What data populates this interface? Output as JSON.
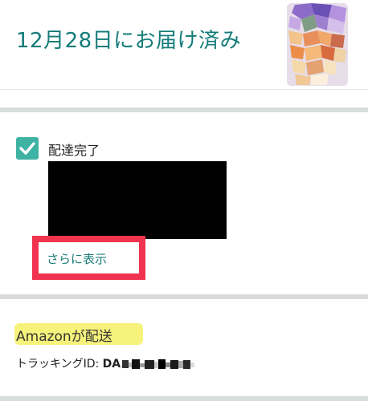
{
  "header": {
    "title": "12月28日にお届け済み",
    "thumbnail_icon": "product-photo-pixelated"
  },
  "delivery": {
    "status_label": "配達完了",
    "checkbox_icon": "checkmark-icon",
    "checked": true,
    "show_more_label": "さらに表示"
  },
  "shipping": {
    "shipper_brand": "Amazon",
    "shipper_suffix": "が配送",
    "tracking_label": "トラッキングID: ",
    "tracking_visible": "DA"
  },
  "colors": {
    "accent_teal": "#127b78",
    "checkbox_green": "#3eb3a4",
    "highlight_red": "#f0344f",
    "highlight_yellow": "#f6f27b",
    "band_gray": "#d9dcdc"
  }
}
